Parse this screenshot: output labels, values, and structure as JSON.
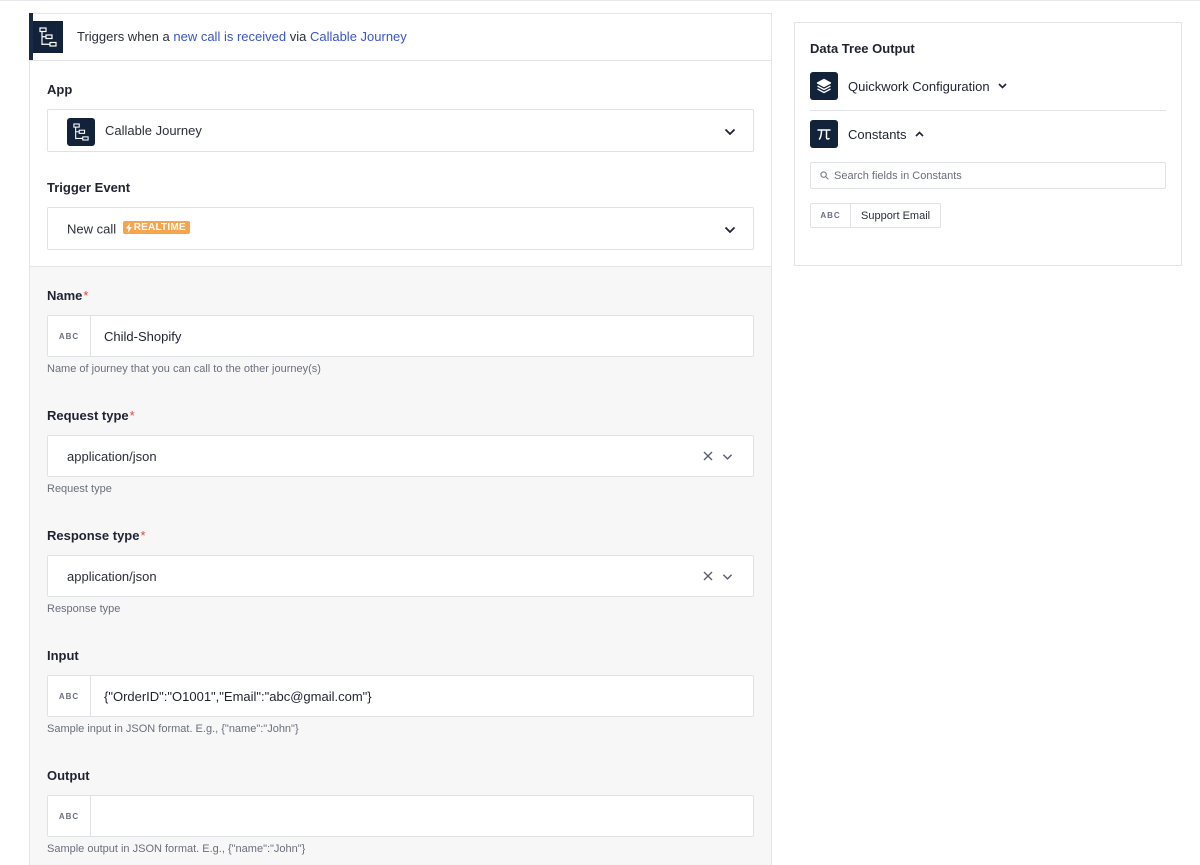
{
  "trigger": {
    "prefix": "Triggers when a",
    "event_link": "new call is received",
    "middle": "via",
    "app_link": "Callable Journey",
    "icon": "flow-diagram-icon"
  },
  "app_field": {
    "label": "App",
    "value": "Callable Journey",
    "icon": "flow-diagram-icon"
  },
  "trigger_event_field": {
    "label": "Trigger Event",
    "value": "New call",
    "badge": "REALTIME"
  },
  "name_field": {
    "label": "Name",
    "type_tag": "ABC",
    "value": "Child-Shopify",
    "hint": "Name of journey that you can call to the other journey(s)"
  },
  "request_type_field": {
    "label": "Request type",
    "value": "application/json",
    "hint": "Request type"
  },
  "response_type_field": {
    "label": "Response type",
    "value": "application/json",
    "hint": "Response type"
  },
  "input_field": {
    "label": "Input",
    "type_tag": "ABC",
    "value": "{\"OrderID\":\"O1001\",\"Email\":\"abc@gmail.com\"}",
    "hint": "Sample input in JSON format. E.g., {\"name\":\"John\"}"
  },
  "output_field": {
    "label": "Output",
    "type_tag": "ABC",
    "value": "",
    "hint": "Sample output in JSON format. E.g., {\"name\":\"John\"}"
  },
  "data_tree": {
    "title": "Data Tree Output",
    "sections": [
      {
        "label": "Quickwork Configuration",
        "icon": "layers-icon",
        "expanded": false
      },
      {
        "label": "Constants",
        "icon": "pi-icon",
        "expanded": true
      }
    ],
    "search_placeholder": "Search fields in Constants",
    "chip": {
      "type_tag": "ABC",
      "label": "Support Email"
    }
  },
  "colors": {
    "brand_dark": "#13223b",
    "link": "#3a55c8",
    "required": "#e0463b",
    "realtime_badge": "#f7a54c",
    "panel_bg": "#f7f7f8"
  }
}
